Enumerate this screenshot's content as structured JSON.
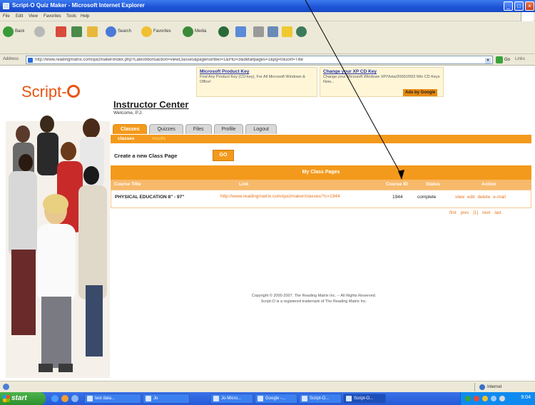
{
  "window": {
    "title": "Script-O Quiz Maker - Microsoft Internet Explorer",
    "min": "_",
    "max": "□",
    "close": "×"
  },
  "menu": {
    "items": [
      "File",
      "Edit",
      "View",
      "Favorites",
      "Tools",
      "Help"
    ]
  },
  "toolbar": {
    "back": "Back",
    "search": "Search",
    "favorites": "Favorites",
    "media": "Media"
  },
  "address": {
    "label": "Address",
    "url": "http://www.readingmatrix.com/quizmaker/index.php?LatestIdonsaction=viewClasses&pagenumber=1&PID=3&detailpages=1&pg=0&sort=Title",
    "go": "Go",
    "links": "Links"
  },
  "ads": [
    {
      "title": "Microsoft Product Key",
      "text": "Find Any Product Key (CD-key), For All Microsoft Windows & Office!"
    },
    {
      "title": "Change your XP CD Key",
      "text": "Change your Microsoft Windows XP/Vista/2000/2003 Win CD Keys Now..."
    }
  ],
  "ads_by": "Ads by Google",
  "logo": {
    "text": "Script-"
  },
  "page": {
    "title": "Instructor Center",
    "welcome": "Welcome, P.J."
  },
  "tabs": [
    "Classes",
    "Quizzes",
    "Files",
    "Profile",
    "Logout"
  ],
  "subnav": {
    "current": "classes",
    "other": "results"
  },
  "create": {
    "label": "Create a new Class Page",
    "button": "GO"
  },
  "table": {
    "title": "My Class Pages",
    "columns": [
      "Course Title",
      "Link",
      "Course ID",
      "Status",
      "Action"
    ],
    "rows": [
      {
        "course": "PHYSICAL EDUCATION 8\" - 97\"",
        "link": "http://www.readingmatrix.com/quizmaker/classes/?c=1944",
        "id": "1944",
        "status": "complete",
        "actions": [
          "view",
          "edit",
          "delete",
          "e-mail"
        ]
      }
    ],
    "pager": [
      "first",
      "prev",
      "[1]",
      "next",
      "last"
    ]
  },
  "footer": {
    "line1": "Copyright © 2000-2007. The Reading Matrix Inc. -- All Rights Reserved.",
    "line2": "Script-O is a registered trademark of The Reading Matrix Inc."
  },
  "status": {
    "zone": "Internet"
  },
  "taskbar": {
    "start": "start",
    "tasks": [
      "test data...",
      "Jo",
      "Jo-Micro...",
      "Google -...",
      "Script-O...",
      "Script-O..."
    ],
    "clock": "9:04"
  }
}
